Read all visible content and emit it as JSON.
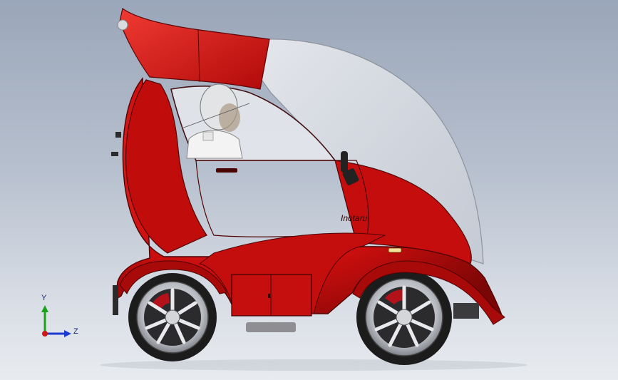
{
  "viewport": {
    "background_top": "#9aa6b9",
    "background_bottom": "#e8ebef"
  },
  "model": {
    "body_color": "#d10f0f",
    "canopy_color": "#dde0e6",
    "tire_color": "#1c1c1c",
    "rim_color": "#c9ccd1",
    "brake_color": "#b3121a",
    "badge_text": "Inotaru"
  },
  "axis_triad": {
    "y_label": "Y",
    "z_label": "Z",
    "x_color": "#d01616",
    "y_color": "#1aa31a",
    "z_color": "#1a3ad0"
  }
}
